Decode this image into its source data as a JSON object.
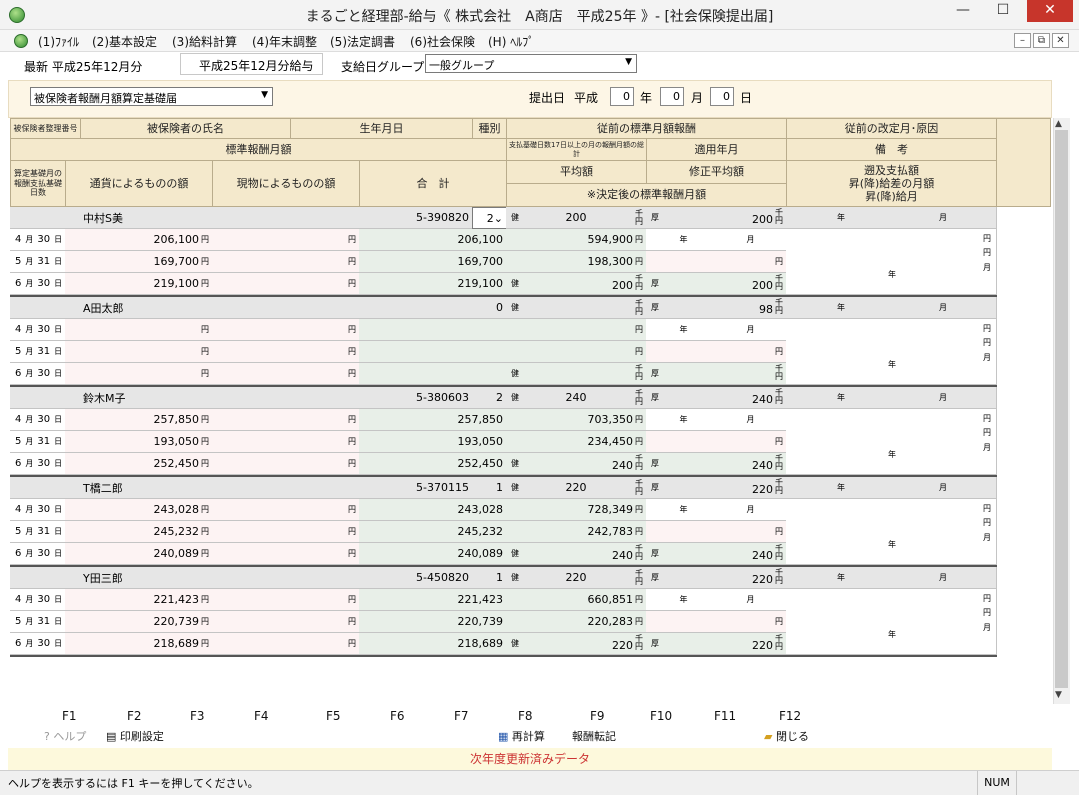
{
  "window": {
    "title": "まるごと経理部-給与《 株式会社　A商店　平成25年 》- [社会保険提出届]",
    "min": "—",
    "max": "☐",
    "close": "✕"
  },
  "menu": [
    "(1)ﾌｧｲﾙ",
    "(2)基本設定",
    "(3)給料計算",
    "(4)年末調整",
    "(5)法定調書",
    "(6)社会保険",
    "(H) ﾍﾙﾌﾟ"
  ],
  "mdi": {
    "min": "–",
    "restore": "⧉",
    "close": "✕"
  },
  "info": {
    "latest": "最新  平成25年12月分",
    "current": "平成25年12月分給与",
    "group_label": "支給日グループ",
    "group_value": "一般グループ"
  },
  "form_select": "被保険者報酬月額算定基礎届",
  "submit": {
    "label": "提出日",
    "era": "平成",
    "year": "0",
    "year_unit": "年",
    "month": "0",
    "month_unit": "月",
    "day": "0",
    "day_unit": "日"
  },
  "headers": {
    "h_no": "被保険者整理番号",
    "h_name": "被保険者の氏名",
    "h_birth": "生年月日",
    "h_kind": "種別",
    "h_prev": "従前の標準月額報酬",
    "h_prevrev": "従前の改定月･原因",
    "h_std": "標準報酬月額",
    "h_pay17": "支払基礎日数17日以上の月の報酬月額の総計",
    "h_applied": "適用年月",
    "h_memo": "備　考",
    "h_days": "算定基礎月の報酬支払基礎日数",
    "h_currency": "通貨によるものの額",
    "h_kind2": "現物によるものの額",
    "h_total": "合　計",
    "h_avg": "平均額",
    "h_modavg": "修正平均額",
    "h_decided": "※決定後の標準報酬月額",
    "h_extra": "遡及支払額\n昇(降)給差の月額\n昇(降)給月"
  },
  "labels": {
    "yen": "円",
    "sen": "千\n円",
    "health": "健",
    "pension": "厚",
    "nen": "年",
    "tsuki": "月",
    "d": "日"
  },
  "months": [
    {
      "m": "4",
      "d": "30"
    },
    {
      "m": "5",
      "d": "31"
    },
    {
      "m": "6",
      "d": "30"
    }
  ],
  "people": [
    {
      "name": "中村S美",
      "birth": "5-390820",
      "kind": "2",
      "health": "200",
      "pension": "200",
      "rows": [
        {
          "cur": "206,100",
          "total": "206,100"
        },
        {
          "cur": "169,700",
          "total": "169,700"
        },
        {
          "cur": "219,100",
          "total": "219,100"
        }
      ],
      "sum": "594,900",
      "avg": "198,300",
      "dh": "200",
      "dp": "200"
    },
    {
      "name": "A田太郎",
      "birth": "",
      "kind": "0",
      "health": "",
      "pension": "98",
      "rows": [
        {
          "cur": "",
          "total": ""
        },
        {
          "cur": "",
          "total": ""
        },
        {
          "cur": "",
          "total": ""
        }
      ],
      "sum": "",
      "avg": "",
      "dh": "",
      "dp": ""
    },
    {
      "name": "鈴木M子",
      "birth": "5-380603",
      "kind": "2",
      "health": "240",
      "pension": "240",
      "rows": [
        {
          "cur": "257,850",
          "total": "257,850"
        },
        {
          "cur": "193,050",
          "total": "193,050"
        },
        {
          "cur": "252,450",
          "total": "252,450"
        }
      ],
      "sum": "703,350",
      "avg": "234,450",
      "dh": "240",
      "dp": "240"
    },
    {
      "name": "T橋二郎",
      "birth": "5-370115",
      "kind": "1",
      "health": "220",
      "pension": "220",
      "rows": [
        {
          "cur": "243,028",
          "total": "243,028"
        },
        {
          "cur": "245,232",
          "total": "245,232"
        },
        {
          "cur": "240,089",
          "total": "240,089"
        }
      ],
      "sum": "728,349",
      "avg": "242,783",
      "dh": "240",
      "dp": "240"
    },
    {
      "name": "Y田三郎",
      "birth": "5-450820",
      "kind": "1",
      "health": "220",
      "pension": "220",
      "rows": [
        {
          "cur": "221,423",
          "total": "221,423"
        },
        {
          "cur": "220,739",
          "total": "220,739"
        },
        {
          "cur": "218,689",
          "total": "218,689"
        }
      ],
      "sum": "660,851",
      "avg": "220,283",
      "dh": "220",
      "dp": "220"
    }
  ],
  "fkeys": [
    "F1",
    "F2",
    "F3",
    "F4",
    "F5",
    "F6",
    "F7",
    "F8",
    "F9",
    "F10",
    "F11",
    "F12"
  ],
  "flabels": {
    "help": "ヘルプ",
    "print": "印刷設定",
    "recalc": "再計算",
    "transfer": "報酬転記",
    "close": "閉じる"
  },
  "banner": "次年度更新済みデータ",
  "status": {
    "help": "ヘルプを表示するには F1 キーを押してください。",
    "num": "NUM"
  },
  "colors": {
    "header_bg": "#f4e9cc",
    "name_row": "#e6e6e6",
    "pink_cell": "#fdf3f3",
    "green_cell": "#e8efe8",
    "banner_text": "#cc3333"
  }
}
